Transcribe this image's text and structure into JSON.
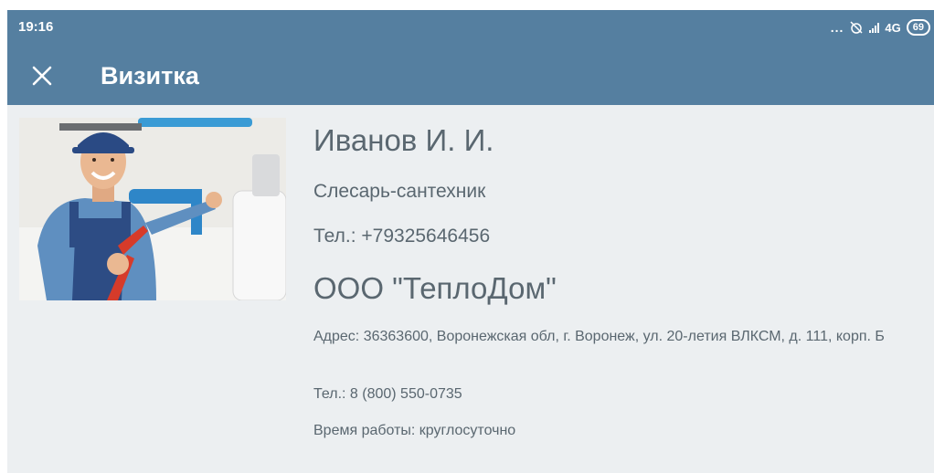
{
  "status_bar": {
    "time": "19:16",
    "dots": "...",
    "network": "4G",
    "battery": "69"
  },
  "app_bar": {
    "close_icon": "close-icon",
    "title": "Визитка"
  },
  "card": {
    "photo_icon": "plumber-photo",
    "name": "Иванов И. И.",
    "position": "Слесарь-сантехник",
    "phone": "Тел.: +79325646456",
    "company": "ООО \"ТеплоДом\"",
    "address": "Адрес: 36363600, Воронежская обл, г. Воронеж, ул. 20-летия ВЛКСМ, д. 111, корп. Б",
    "company_phone": "Тел.: 8 (800) 550-0735",
    "working_hours": "Время работы: круглосуточно"
  },
  "colors": {
    "primary": "#557fa0",
    "background": "#eceff1",
    "text": "#5a6770"
  }
}
